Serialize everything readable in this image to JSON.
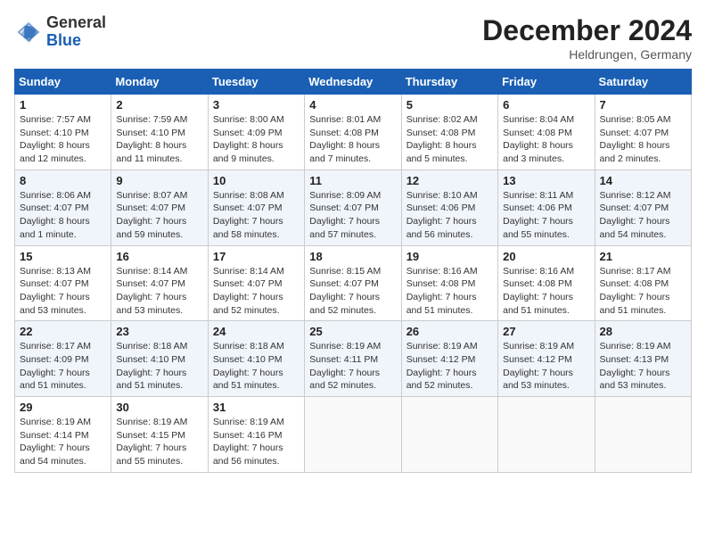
{
  "header": {
    "logo_general": "General",
    "logo_blue": "Blue",
    "month_title": "December 2024",
    "subtitle": "Heldrungen, Germany"
  },
  "calendar": {
    "columns": [
      "Sunday",
      "Monday",
      "Tuesday",
      "Wednesday",
      "Thursday",
      "Friday",
      "Saturday"
    ],
    "rows": [
      [
        {
          "day": "1",
          "info": "Sunrise: 7:57 AM\nSunset: 4:10 PM\nDaylight: 8 hours\nand 12 minutes."
        },
        {
          "day": "2",
          "info": "Sunrise: 7:59 AM\nSunset: 4:10 PM\nDaylight: 8 hours\nand 11 minutes."
        },
        {
          "day": "3",
          "info": "Sunrise: 8:00 AM\nSunset: 4:09 PM\nDaylight: 8 hours\nand 9 minutes."
        },
        {
          "day": "4",
          "info": "Sunrise: 8:01 AM\nSunset: 4:08 PM\nDaylight: 8 hours\nand 7 minutes."
        },
        {
          "day": "5",
          "info": "Sunrise: 8:02 AM\nSunset: 4:08 PM\nDaylight: 8 hours\nand 5 minutes."
        },
        {
          "day": "6",
          "info": "Sunrise: 8:04 AM\nSunset: 4:08 PM\nDaylight: 8 hours\nand 3 minutes."
        },
        {
          "day": "7",
          "info": "Sunrise: 8:05 AM\nSunset: 4:07 PM\nDaylight: 8 hours\nand 2 minutes."
        }
      ],
      [
        {
          "day": "8",
          "info": "Sunrise: 8:06 AM\nSunset: 4:07 PM\nDaylight: 8 hours\nand 1 minute."
        },
        {
          "day": "9",
          "info": "Sunrise: 8:07 AM\nSunset: 4:07 PM\nDaylight: 7 hours\nand 59 minutes."
        },
        {
          "day": "10",
          "info": "Sunrise: 8:08 AM\nSunset: 4:07 PM\nDaylight: 7 hours\nand 58 minutes."
        },
        {
          "day": "11",
          "info": "Sunrise: 8:09 AM\nSunset: 4:07 PM\nDaylight: 7 hours\nand 57 minutes."
        },
        {
          "day": "12",
          "info": "Sunrise: 8:10 AM\nSunset: 4:06 PM\nDaylight: 7 hours\nand 56 minutes."
        },
        {
          "day": "13",
          "info": "Sunrise: 8:11 AM\nSunset: 4:06 PM\nDaylight: 7 hours\nand 55 minutes."
        },
        {
          "day": "14",
          "info": "Sunrise: 8:12 AM\nSunset: 4:07 PM\nDaylight: 7 hours\nand 54 minutes."
        }
      ],
      [
        {
          "day": "15",
          "info": "Sunrise: 8:13 AM\nSunset: 4:07 PM\nDaylight: 7 hours\nand 53 minutes."
        },
        {
          "day": "16",
          "info": "Sunrise: 8:14 AM\nSunset: 4:07 PM\nDaylight: 7 hours\nand 53 minutes."
        },
        {
          "day": "17",
          "info": "Sunrise: 8:14 AM\nSunset: 4:07 PM\nDaylight: 7 hours\nand 52 minutes."
        },
        {
          "day": "18",
          "info": "Sunrise: 8:15 AM\nSunset: 4:07 PM\nDaylight: 7 hours\nand 52 minutes."
        },
        {
          "day": "19",
          "info": "Sunrise: 8:16 AM\nSunset: 4:08 PM\nDaylight: 7 hours\nand 51 minutes."
        },
        {
          "day": "20",
          "info": "Sunrise: 8:16 AM\nSunset: 4:08 PM\nDaylight: 7 hours\nand 51 minutes."
        },
        {
          "day": "21",
          "info": "Sunrise: 8:17 AM\nSunset: 4:08 PM\nDaylight: 7 hours\nand 51 minutes."
        }
      ],
      [
        {
          "day": "22",
          "info": "Sunrise: 8:17 AM\nSunset: 4:09 PM\nDaylight: 7 hours\nand 51 minutes."
        },
        {
          "day": "23",
          "info": "Sunrise: 8:18 AM\nSunset: 4:10 PM\nDaylight: 7 hours\nand 51 minutes."
        },
        {
          "day": "24",
          "info": "Sunrise: 8:18 AM\nSunset: 4:10 PM\nDaylight: 7 hours\nand 51 minutes."
        },
        {
          "day": "25",
          "info": "Sunrise: 8:19 AM\nSunset: 4:11 PM\nDaylight: 7 hours\nand 52 minutes."
        },
        {
          "day": "26",
          "info": "Sunrise: 8:19 AM\nSunset: 4:12 PM\nDaylight: 7 hours\nand 52 minutes."
        },
        {
          "day": "27",
          "info": "Sunrise: 8:19 AM\nSunset: 4:12 PM\nDaylight: 7 hours\nand 53 minutes."
        },
        {
          "day": "28",
          "info": "Sunrise: 8:19 AM\nSunset: 4:13 PM\nDaylight: 7 hours\nand 53 minutes."
        }
      ],
      [
        {
          "day": "29",
          "info": "Sunrise: 8:19 AM\nSunset: 4:14 PM\nDaylight: 7 hours\nand 54 minutes."
        },
        {
          "day": "30",
          "info": "Sunrise: 8:19 AM\nSunset: 4:15 PM\nDaylight: 7 hours\nand 55 minutes."
        },
        {
          "day": "31",
          "info": "Sunrise: 8:19 AM\nSunset: 4:16 PM\nDaylight: 7 hours\nand 56 minutes."
        },
        null,
        null,
        null,
        null
      ]
    ]
  }
}
